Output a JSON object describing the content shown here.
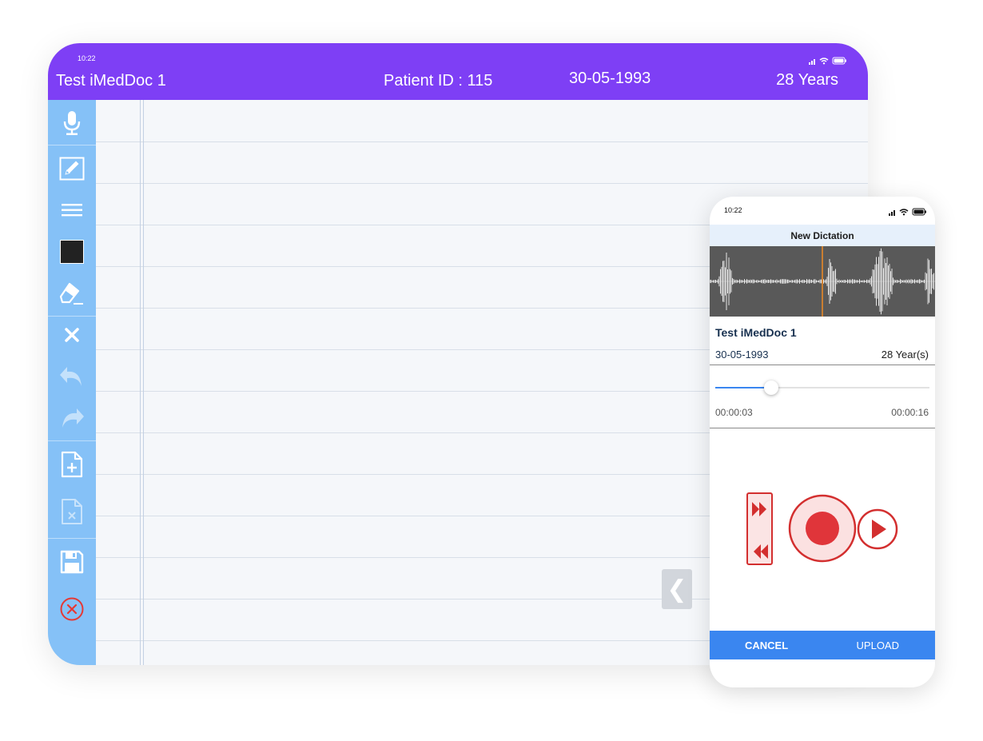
{
  "tablet": {
    "status_time": "10:22",
    "patient_name": "Test iMedDoc 1",
    "patient_id": "Patient ID : 115",
    "dob": "30-05-1993",
    "age": "28 Years",
    "toolbar": {
      "items": [
        {
          "icon": "microphone-icon"
        },
        {
          "icon": "pencil-icon"
        },
        {
          "icon": "line-weight-icon"
        },
        {
          "icon": "color-swatch-icon",
          "color": "#222222"
        },
        {
          "icon": "eraser-icon"
        },
        {
          "icon": "clear-icon"
        },
        {
          "icon": "undo-icon"
        },
        {
          "icon": "redo-icon"
        },
        {
          "icon": "add-page-icon"
        },
        {
          "icon": "delete-page-icon"
        },
        {
          "icon": "save-icon"
        },
        {
          "icon": "close-circle-icon"
        }
      ]
    },
    "collapse_glyph": "❮",
    "colors": {
      "header": "#7e3ff5",
      "sidebar": "#85c1f7",
      "close": "#e53935"
    }
  },
  "phone": {
    "status_time": "10:22",
    "title": "New Dictation",
    "patient_name": "Test iMedDoc 1",
    "dob": "30-05-1993",
    "age": "28 Year(s)",
    "playback": {
      "elapsed": "00:00:03",
      "total": "00:00:16",
      "progress": 0.26
    },
    "cancel_label": "CANCEL",
    "upload_label": "UPLOAD",
    "colors": {
      "accent": "#3a86f0",
      "record": "#d32f2f",
      "playhead": "#f08a24"
    }
  }
}
